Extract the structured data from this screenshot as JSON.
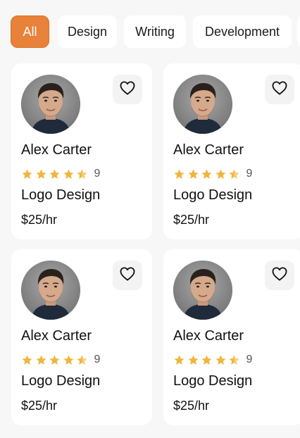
{
  "filters": {
    "chips": [
      {
        "label": "All",
        "active": true
      },
      {
        "label": "Design",
        "active": false
      },
      {
        "label": "Writing",
        "active": false
      },
      {
        "label": "Development",
        "active": false
      }
    ],
    "accent_color": "#e8813a"
  },
  "cards": [
    {
      "name": "Alex Carter",
      "rating": 4.5,
      "review_count": "9",
      "skill": "Logo Design",
      "price": "$25/hr",
      "favorite_icon": "heart-outline-icon"
    },
    {
      "name": "Alex Carter",
      "rating": 4.5,
      "review_count": "9",
      "skill": "Logo Design",
      "price": "$25/hr",
      "favorite_icon": "heart-outline-icon"
    },
    {
      "name": "Alex Carter",
      "rating": 4.5,
      "review_count": "9",
      "skill": "Logo Design",
      "price": "$25/hr",
      "favorite_icon": "heart-outline-icon"
    },
    {
      "name": "Alex Carter",
      "rating": 4.5,
      "review_count": "9",
      "skill": "Logo Design",
      "price": "$25/hr",
      "favorite_icon": "heart-outline-icon"
    }
  ],
  "star_color": "#f0b53c"
}
